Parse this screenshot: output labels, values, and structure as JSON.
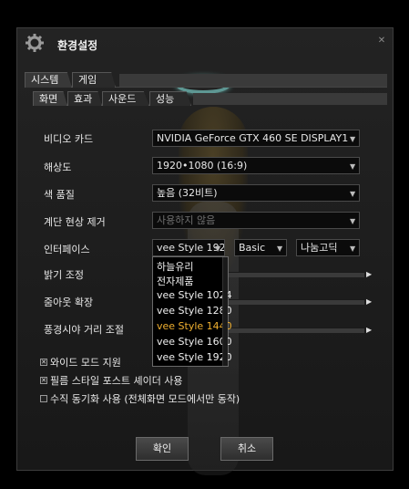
{
  "window": {
    "title": "환경설정"
  },
  "tabs_main": [
    {
      "label": "시스템",
      "active": true
    },
    {
      "label": "게임",
      "active": false
    }
  ],
  "tabs_sub": [
    {
      "label": "화면",
      "active": true
    },
    {
      "label": "효과",
      "active": false
    },
    {
      "label": "사운드",
      "active": false
    },
    {
      "label": "성능",
      "active": false
    }
  ],
  "settings": {
    "video_card": {
      "label": "비디오 카드",
      "value": "NVIDIA GeForce GTX 460 SE DISPLAY1"
    },
    "resolution": {
      "label": "해상도",
      "value": "1920•1080 (16:9)"
    },
    "color_quality": {
      "label": "색 품질",
      "value": "높음 (32비트)"
    },
    "banding": {
      "label": "계단 현상 제거",
      "value": "사용하지 않음",
      "disabled": true
    },
    "interface": {
      "label": "인터페이스",
      "style_value": "vee Style 192",
      "preset_value": "Basic",
      "font_value": "나눔고딕"
    },
    "brightness": {
      "label": "밝기 조정"
    },
    "zoom_out": {
      "label": "줌아웃 확장"
    },
    "view_distance": {
      "label": "풍경시야 거리 조절"
    }
  },
  "interface_dropdown": {
    "options": [
      "하늘유리",
      "전자제품",
      "vee Style 1024",
      "vee Style 1280",
      "vee Style 1440",
      "vee Style 1600",
      "vee Style 1920"
    ],
    "highlighted": "vee Style 1440"
  },
  "checkboxes": [
    {
      "label": "와이드 모드 지원",
      "checked": true
    },
    {
      "label": "필름 스타일 포스트 셰이더 사용",
      "checked": true
    },
    {
      "label": "수직 동기화 사용 (전체화면 모드에서만 동작)",
      "checked": false
    }
  ],
  "buttons": {
    "confirm": "확인",
    "cancel": "취소"
  },
  "colors": {
    "accent_highlight": "#f0b030",
    "halo": "#7fd6d0"
  }
}
